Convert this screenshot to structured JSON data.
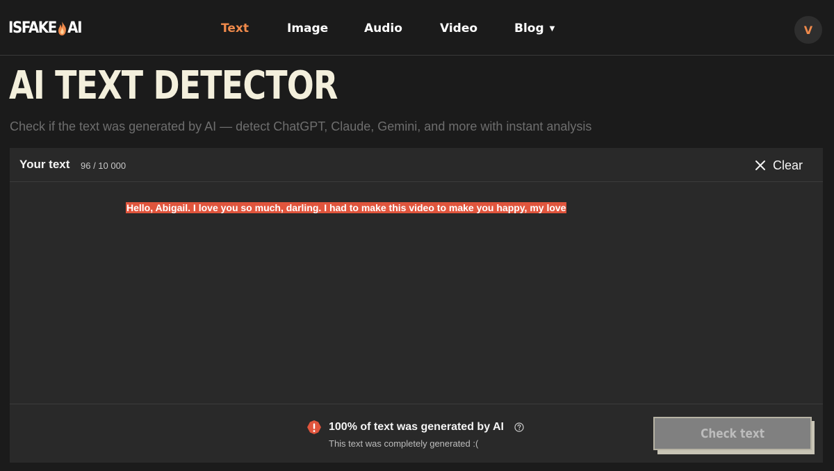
{
  "header": {
    "logo_left": "ISFAKE",
    "logo_right": "AI",
    "logo_icon": "flame-icon",
    "nav": [
      {
        "label": "Text",
        "active": true
      },
      {
        "label": "Image",
        "active": false
      },
      {
        "label": "Audio",
        "active": false
      },
      {
        "label": "Video",
        "active": false
      },
      {
        "label": "Blog",
        "active": false,
        "has_dropdown": true
      }
    ],
    "avatar_initial": "V"
  },
  "page": {
    "title": "AI TEXT DETECTOR",
    "subtitle": "Check if the text was generated by AI — detect ChatGPT, Claude, Gemini, and more with instant analysis"
  },
  "editor": {
    "label": "Your text",
    "char_count": "96 / 10 000",
    "clear_label": "Clear",
    "content": "Hello, Abigail. I love you so much, darling. I had to make this video to make you happy, my love"
  },
  "result": {
    "title": "100% of text was generated by AI",
    "subtitle": "This text was completely generated :(",
    "status_icon": "alert-icon"
  },
  "actions": {
    "check_label": "Check text"
  },
  "colors": {
    "accent": "#f08a4b",
    "highlight_ai": "#e0553d",
    "background": "#1b1b1b",
    "panel": "#292929"
  }
}
